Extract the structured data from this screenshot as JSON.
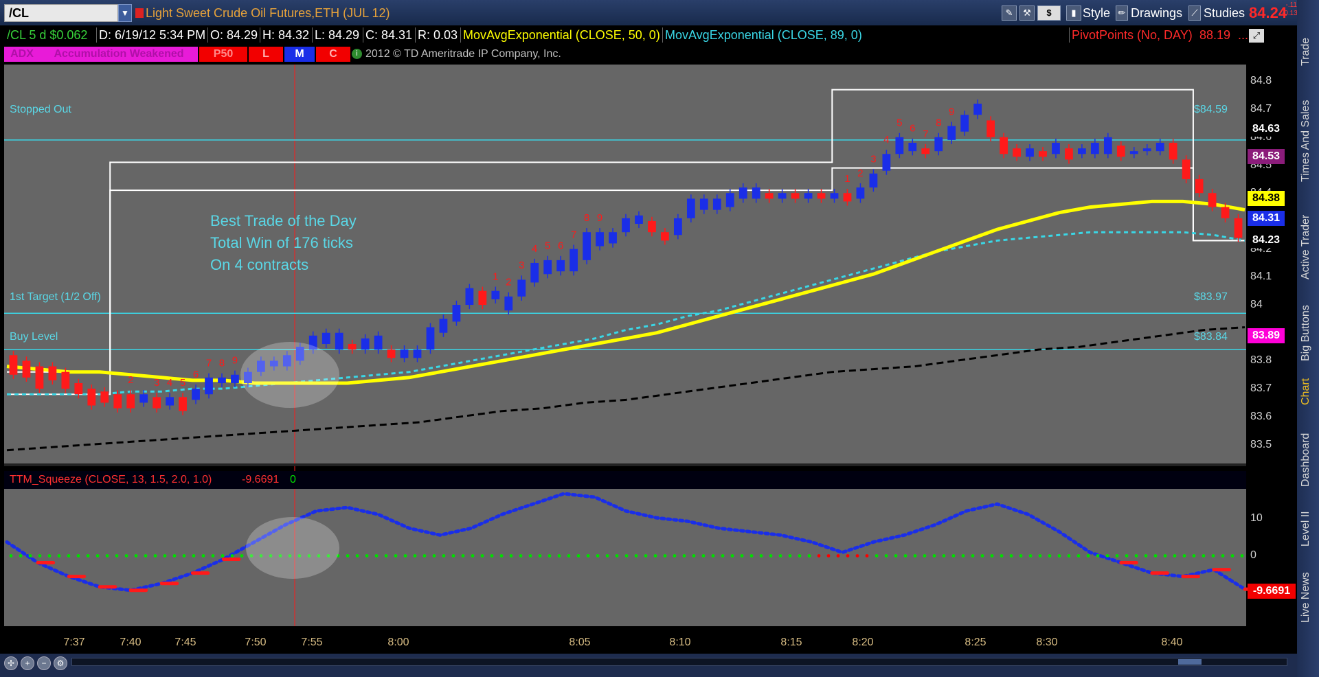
{
  "toolbar": {
    "symbol": "/CL",
    "description": "Light Sweet Crude Oil Futures,ETH (JUL 12)",
    "style_label": "Style",
    "drawings_label": "Drawings",
    "studies_label": "Studies",
    "dollar_label": "$",
    "last_price": "84.24",
    "change_abs": "-.11",
    "change_pct": "-0.13%"
  },
  "infobar": {
    "agg": "/CL 5 d $0.062",
    "date": "D: 6/19/12 5:34 PM",
    "open": "O: 84.29",
    "high": "H: 84.32",
    "low": "L: 84.29",
    "close": "C: 84.31",
    "range": "R: 0.03",
    "ema50": "MovAvgExponential (CLOSE, 50, 0)",
    "ema89": "MovAvgExponential (CLOSE, 89, 0)",
    "pivot": "PivotPoints (No, DAY)",
    "pivot_val": "88.19",
    "ellipsis": "..."
  },
  "studybar": {
    "adx": "ADX",
    "accum": "Accumulation Weakened",
    "p50": "P50",
    "l": "L",
    "m": "M",
    "c": "C",
    "copyright": "2012 © TD Ameritrade IP Company, Inc.",
    "copyright_icon": "i"
  },
  "levels": {
    "stopped_out": "Stopped Out",
    "stopped_out_price": "$84.59",
    "first_target": "1st Target (1/2 Off)",
    "first_target_price": "$83.97",
    "buy_level": "Buy Level",
    "buy_level_price": "$83.84"
  },
  "annotation": {
    "line1": "Best Trade of the Day",
    "line2": "Total Win of 176 ticks",
    "line3": "On 4 contracts"
  },
  "price_tags": [
    {
      "label": "84.63",
      "bg": "#000000",
      "fg": "#ffffff",
      "value": 84.63
    },
    {
      "label": "84.53",
      "bg": "#8b1c7a",
      "fg": "#ffffff",
      "value": 84.53
    },
    {
      "label": "84.38",
      "bg": "#ffff00",
      "fg": "#000000",
      "value": 84.38
    },
    {
      "label": "84.31",
      "bg": "#1a2ee8",
      "fg": "#ffffff",
      "value": 84.31
    },
    {
      "label": "84.23",
      "bg": "#000000",
      "fg": "#ffffff",
      "value": 84.23
    },
    {
      "label": "83.89",
      "bg": "#ff00d8",
      "fg": "#ffffff",
      "value": 83.89
    }
  ],
  "lower": {
    "title": "TTM_Squeeze (CLOSE, 13, 1.5, 2.0, 1.0)",
    "value": "-9.6691",
    "signal": "0",
    "tag": "-9.6691"
  },
  "right_tabs": [
    "Trade",
    "Times And Sales",
    "Active Trader",
    "Big Buttons",
    "Chart",
    "Dashboard",
    "Level II",
    "Live News"
  ],
  "colors": {
    "bull": "#1a2ee8",
    "bear": "#ff1a1a",
    "ema50": "#ffff00",
    "ema89": "#3ad7e6",
    "level": "#3ad7e6",
    "squeeze_on": "#ff0000",
    "squeeze_off": "#00e000"
  },
  "chart_data": [
    {
      "type": "candlestick",
      "title": "",
      "x_labels": [
        "7:37",
        "7:40",
        "7:45",
        "7:50",
        "7:55",
        "8:00",
        "8:05",
        "8:10",
        "8:15",
        "8:20",
        "8:25",
        "8:30",
        "8:40"
      ],
      "y_ticks": [
        83.5,
        83.6,
        83.7,
        83.8,
        83.9,
        84,
        84.1,
        84.2,
        84.3,
        84.4,
        84.5,
        84.6,
        84.7,
        84.8
      ],
      "ylim": [
        83.43,
        84.86
      ],
      "grid": false,
      "bars": [
        {
          "o": 83.82,
          "c": 83.75
        },
        {
          "o": 83.8,
          "c": 83.74
        },
        {
          "o": 83.78,
          "c": 83.7
        },
        {
          "o": 83.78,
          "c": 83.73
        },
        {
          "o": 83.76,
          "c": 83.7
        },
        {
          "o": 83.72,
          "c": 83.68
        },
        {
          "o": 83.7,
          "c": 83.64
        },
        {
          "o": 83.69,
          "c": 83.65
        },
        {
          "o": 83.68,
          "c": 83.63
        },
        {
          "o": 83.68,
          "c": 83.63
        },
        {
          "o": 83.65,
          "c": 83.68
        },
        {
          "o": 83.67,
          "c": 83.63
        },
        {
          "o": 83.64,
          "c": 83.67
        },
        {
          "o": 83.67,
          "c": 83.62
        },
        {
          "o": 83.66,
          "c": 83.7
        },
        {
          "o": 83.68,
          "c": 83.74
        },
        {
          "o": 83.72,
          "c": 83.74
        },
        {
          "o": 83.72,
          "c": 83.75
        },
        {
          "o": 83.72,
          "c": 83.76
        },
        {
          "o": 83.76,
          "c": 83.8
        },
        {
          "o": 83.78,
          "c": 83.8
        },
        {
          "o": 83.78,
          "c": 83.82
        },
        {
          "o": 83.8,
          "c": 83.85
        },
        {
          "o": 83.84,
          "c": 83.89
        },
        {
          "o": 83.86,
          "c": 83.9
        },
        {
          "o": 83.84,
          "c": 83.9
        },
        {
          "o": 83.86,
          "c": 83.84
        },
        {
          "o": 83.84,
          "c": 83.88
        },
        {
          "o": 83.84,
          "c": 83.89
        },
        {
          "o": 83.84,
          "c": 83.81
        },
        {
          "o": 83.81,
          "c": 83.84
        },
        {
          "o": 83.81,
          "c": 83.84
        },
        {
          "o": 83.84,
          "c": 83.92
        },
        {
          "o": 83.9,
          "c": 83.95
        },
        {
          "o": 83.94,
          "c": 84.0
        },
        {
          "o": 84.0,
          "c": 84.06
        },
        {
          "o": 84.05,
          "c": 84.0
        },
        {
          "o": 84.02,
          "c": 84.05
        },
        {
          "o": 83.98,
          "c": 84.03
        },
        {
          "o": 84.03,
          "c": 84.09
        },
        {
          "o": 84.08,
          "c": 84.15
        },
        {
          "o": 84.11,
          "c": 84.16
        },
        {
          "o": 84.12,
          "c": 84.16
        },
        {
          "o": 84.12,
          "c": 84.2
        },
        {
          "o": 84.16,
          "c": 84.26
        },
        {
          "o": 84.21,
          "c": 84.26
        },
        {
          "o": 84.22,
          "c": 84.26
        },
        {
          "o": 84.26,
          "c": 84.31
        },
        {
          "o": 84.29,
          "c": 84.32
        },
        {
          "o": 84.3,
          "c": 84.26
        },
        {
          "o": 84.26,
          "c": 84.23
        },
        {
          "o": 84.25,
          "c": 84.31
        },
        {
          "o": 84.31,
          "c": 84.38
        },
        {
          "o": 84.34,
          "c": 84.38
        },
        {
          "o": 84.34,
          "c": 84.38
        },
        {
          "o": 84.35,
          "c": 84.4
        },
        {
          "o": 84.38,
          "c": 84.42
        },
        {
          "o": 84.38,
          "c": 84.42
        },
        {
          "o": 84.4,
          "c": 84.38
        },
        {
          "o": 84.38,
          "c": 84.4
        },
        {
          "o": 84.4,
          "c": 84.38
        },
        {
          "o": 84.38,
          "c": 84.4
        },
        {
          "o": 84.4,
          "c": 84.38
        },
        {
          "o": 84.38,
          "c": 84.4
        },
        {
          "o": 84.4,
          "c": 84.37
        },
        {
          "o": 84.38,
          "c": 84.42
        },
        {
          "o": 84.42,
          "c": 84.47
        },
        {
          "o": 84.48,
          "c": 84.54
        },
        {
          "o": 84.54,
          "c": 84.6
        },
        {
          "o": 84.55,
          "c": 84.58
        },
        {
          "o": 84.56,
          "c": 84.54
        },
        {
          "o": 84.55,
          "c": 84.6
        },
        {
          "o": 84.59,
          "c": 84.64
        },
        {
          "o": 84.62,
          "c": 84.68
        },
        {
          "o": 84.68,
          "c": 84.72
        },
        {
          "o": 84.66,
          "c": 84.6
        },
        {
          "o": 84.6,
          "c": 84.54
        },
        {
          "o": 84.56,
          "c": 84.53
        },
        {
          "o": 84.53,
          "c": 84.56
        },
        {
          "o": 84.55,
          "c": 84.53
        },
        {
          "o": 84.54,
          "c": 84.58
        },
        {
          "o": 84.56,
          "c": 84.52
        },
        {
          "o": 84.54,
          "c": 84.56
        },
        {
          "o": 84.54,
          "c": 84.58
        },
        {
          "o": 84.54,
          "c": 84.6
        },
        {
          "o": 84.57,
          "c": 84.53
        },
        {
          "o": 84.54,
          "c": 84.55
        },
        {
          "o": 84.55,
          "c": 84.56
        },
        {
          "o": 84.55,
          "c": 84.58
        },
        {
          "o": 84.58,
          "c": 84.52
        },
        {
          "o": 84.52,
          "c": 84.45
        },
        {
          "o": 84.45,
          "c": 84.4
        },
        {
          "o": 84.4,
          "c": 84.35
        },
        {
          "o": 84.35,
          "c": 84.31
        },
        {
          "o": 84.31,
          "c": 84.24
        }
      ],
      "seq_labels": [
        {
          "i": 9,
          "n": "2"
        },
        {
          "i": 11,
          "n": "3"
        },
        {
          "i": 12,
          "n": "4"
        },
        {
          "i": 13,
          "n": "5"
        },
        {
          "i": 14,
          "n": "6"
        },
        {
          "i": 15,
          "n": "7"
        },
        {
          "i": 16,
          "n": "8"
        },
        {
          "i": 17,
          "n": "9"
        },
        {
          "i": 37,
          "n": "1"
        },
        {
          "i": 38,
          "n": "2"
        },
        {
          "i": 39,
          "n": "3"
        },
        {
          "i": 40,
          "n": "4"
        },
        {
          "i": 41,
          "n": "5"
        },
        {
          "i": 42,
          "n": "6"
        },
        {
          "i": 43,
          "n": "7"
        },
        {
          "i": 44,
          "n": "8"
        },
        {
          "i": 45,
          "n": "9"
        },
        {
          "i": 64,
          "n": "1"
        },
        {
          "i": 65,
          "n": "2"
        },
        {
          "i": 66,
          "n": "3"
        },
        {
          "i": 67,
          "n": "4"
        },
        {
          "i": 68,
          "n": "5"
        },
        {
          "i": 69,
          "n": "6"
        },
        {
          "i": 70,
          "n": "7"
        },
        {
          "i": 71,
          "n": "8"
        },
        {
          "i": 72,
          "n": "9"
        }
      ],
      "horizontal_levels": [
        84.59,
        83.97,
        83.84
      ],
      "ema50": [
        83.78,
        83.77,
        83.76,
        83.76,
        83.75,
        83.74,
        83.73,
        83.73,
        83.72,
        83.72,
        83.72,
        83.72,
        83.73,
        83.74,
        83.76,
        83.78,
        83.8,
        83.82,
        83.84,
        83.86,
        83.88,
        83.9,
        83.93,
        83.96,
        83.99,
        84.02,
        84.05,
        84.08,
        84.11,
        84.15,
        84.19,
        84.23,
        84.27,
        84.3,
        84.33,
        84.35,
        84.36,
        84.37,
        84.37,
        84.36,
        84.34
      ],
      "ema89": [
        83.68,
        83.68,
        83.68,
        83.68,
        83.69,
        83.69,
        83.7,
        83.7,
        83.71,
        83.72,
        83.73,
        83.74,
        83.75,
        83.76,
        83.78,
        83.8,
        83.82,
        83.84,
        83.86,
        83.88,
        83.91,
        83.93,
        83.96,
        83.98,
        84.01,
        84.04,
        84.07,
        84.1,
        84.13,
        84.16,
        84.19,
        84.21,
        84.23,
        84.24,
        84.25,
        84.26,
        84.26,
        84.26,
        84.26,
        84.25,
        84.23
      ],
      "slow_ma": [
        83.48,
        83.49,
        83.5,
        83.51,
        83.52,
        83.53,
        83.54,
        83.55,
        83.56,
        83.57,
        83.58,
        83.6,
        83.62,
        83.63,
        83.65,
        83.66,
        83.68,
        83.7,
        83.72,
        83.74,
        83.76,
        83.77,
        83.78,
        83.8,
        83.82,
        83.84,
        83.85,
        83.87,
        83.89,
        83.91,
        83.92
      ],
      "upper_channel": [
        83.76,
        83.76,
        84.51,
        84.51,
        84.51,
        84.51,
        84.51,
        84.51,
        84.51,
        84.51,
        84.51,
        84.51,
        84.51,
        84.51,
        84.51,
        84.51,
        84.77,
        84.77,
        84.77,
        84.77,
        84.77,
        84.77,
        84.77,
        84.23,
        84.23
      ],
      "lower_channel": [
        83.68,
        83.68,
        84.41,
        84.41,
        84.41,
        84.41,
        84.41,
        84.41,
        84.41,
        84.41,
        84.41,
        84.41,
        84.41,
        84.41,
        84.41,
        84.41,
        84.49,
        84.49,
        84.49,
        84.49,
        84.49,
        84.49,
        84.49,
        84.23,
        84.23
      ]
    },
    {
      "type": "line",
      "title": "TTM_Squeeze (CLOSE, 13, 1.5, 2.0, 1.0)",
      "y_ticks": [
        10,
        0
      ],
      "ylim": [
        -20,
        19
      ],
      "x": [
        0,
        1,
        2,
        3,
        4,
        5,
        6,
        7,
        8,
        9,
        10,
        11,
        12,
        13,
        14,
        15,
        16,
        17,
        18,
        19,
        20,
        21,
        22,
        23,
        24,
        25,
        26,
        27,
        28,
        29,
        30,
        31,
        32,
        33,
        34,
        35,
        36,
        37,
        38,
        39,
        40
      ],
      "values": [
        4,
        -2,
        -6,
        -9,
        -10,
        -8,
        -5,
        -1,
        4,
        9,
        13,
        14,
        12,
        8,
        6,
        8,
        12,
        15,
        18,
        17,
        13,
        11,
        10,
        8,
        7,
        6,
        4,
        1,
        4,
        6,
        9,
        13,
        15,
        12,
        7,
        1,
        -2,
        -5,
        -6,
        -4,
        -9.6691
      ],
      "squeeze_on_from_index": 26
    }
  ]
}
